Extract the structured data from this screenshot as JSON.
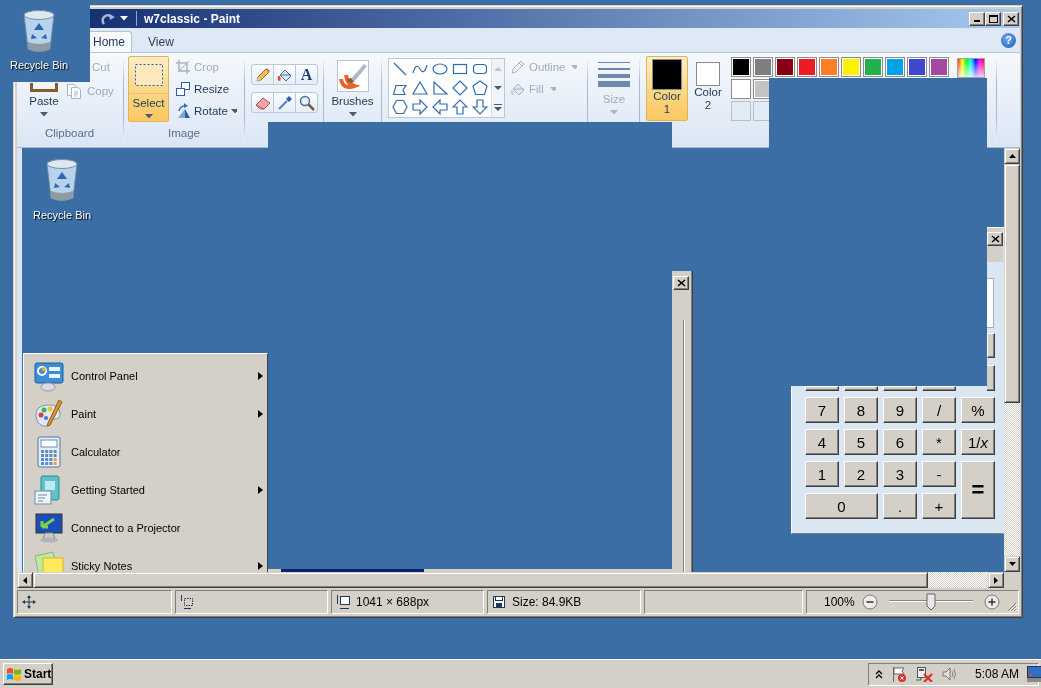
{
  "desktop_icons": [
    {
      "label": "Recycle Bin"
    }
  ],
  "window": {
    "title": "w7classic - Paint"
  },
  "tabs": [
    {
      "label": "Home",
      "selected": true
    },
    {
      "label": "View",
      "selected": false
    }
  ],
  "help": {
    "glyph": "?"
  },
  "clipboard": {
    "paste": "Paste",
    "items": [
      {
        "label": "Cut",
        "disabled": true
      },
      {
        "label": "Copy",
        "disabled": true
      }
    ],
    "group_label": "Clipboard"
  },
  "image": {
    "select": {
      "label": "Select",
      "selected": true
    },
    "items": [
      {
        "label": "Crop",
        "disabled": true,
        "dropdown": false
      },
      {
        "label": "Resize",
        "disabled": false,
        "dropdown": false
      },
      {
        "label": "Rotate",
        "disabled": false,
        "dropdown": true
      }
    ],
    "group_label": "Image"
  },
  "text_tool": {
    "glyph": "A"
  },
  "brushes": {
    "label": "Brushes"
  },
  "shape_options": [
    {
      "label": "Outline",
      "disabled": true
    },
    {
      "label": "Fill",
      "disabled": true
    }
  ],
  "size": {
    "label": "Size",
    "disabled": true
  },
  "colors": [
    {
      "label": "Color",
      "number": "1",
      "color": "#000000",
      "selected": true
    },
    {
      "label": "Color",
      "number": "2",
      "color": "#ffffff",
      "selected": false
    }
  ],
  "palette_rows": [
    {
      "swatches": [
        {
          "kind": "filled",
          "color": "#000000"
        },
        {
          "kind": "filled",
          "color": "#7f7f7f"
        },
        {
          "kind": "filled",
          "color": "#880015"
        },
        {
          "kind": "filled",
          "color": "#ed1c24"
        },
        {
          "kind": "filled",
          "color": "#ff7f27"
        },
        {
          "kind": "filled",
          "color": "#fff200"
        },
        {
          "kind": "filled",
          "color": "#22b14c"
        },
        {
          "kind": "filled",
          "color": "#00a2e8"
        },
        {
          "kind": "filled",
          "color": "#3f48cc"
        },
        {
          "kind": "filled",
          "color": "#a349a4"
        }
      ]
    },
    {
      "swatches": [
        {
          "kind": "filled",
          "color": "#ffffff"
        },
        {
          "kind": "filled",
          "color": "#c3c3c3"
        }
      ]
    },
    {
      "swatches": [
        {
          "kind": "empty"
        },
        {
          "kind": "empty"
        }
      ]
    }
  ],
  "canvas": {
    "desktop_icons": [
      {
        "label": "Recycle Bin"
      }
    ],
    "start_menu": [
      {
        "label": "Control Panel",
        "submenu": true
      },
      {
        "label": "Paint",
        "submenu": true
      },
      {
        "label": "Calculator",
        "submenu": false
      },
      {
        "label": "Getting Started",
        "submenu": true
      },
      {
        "label": "Connect to a Projector",
        "submenu": false
      },
      {
        "label": "Sticky Notes",
        "submenu": true
      }
    ],
    "calculator": {
      "keys": [
        {
          "label": "7",
          "kind": "key"
        },
        {
          "label": "8",
          "kind": "key"
        },
        {
          "label": "9",
          "kind": "key"
        },
        {
          "label": "/",
          "kind": "key"
        },
        {
          "label": "%",
          "kind": "key"
        },
        {
          "label": "4",
          "kind": "key"
        },
        {
          "label": "5",
          "kind": "key"
        },
        {
          "label": "6",
          "kind": "key"
        },
        {
          "label": "*",
          "kind": "key"
        },
        {
          "label": "1/*x*",
          "kind": "key"
        },
        {
          "label": "1",
          "kind": "key"
        },
        {
          "label": "2",
          "kind": "key"
        },
        {
          "label": "3",
          "kind": "key"
        },
        {
          "label": "-",
          "kind": "key"
        },
        {
          "label": "=",
          "kind": "tall"
        },
        {
          "label": "0",
          "kind": "wide"
        },
        {
          "label": ".",
          "kind": "key"
        },
        {
          "label": "+",
          "kind": "key"
        }
      ]
    }
  },
  "status_bar": {
    "dimensions": "1041 × 688px",
    "file_size": "Size: 84.9KB",
    "zoom": "100%",
    "zoom_slider": {
      "level": 0.5
    }
  },
  "taskbar": {
    "start": "Start",
    "clock": "5:08 AM"
  }
}
